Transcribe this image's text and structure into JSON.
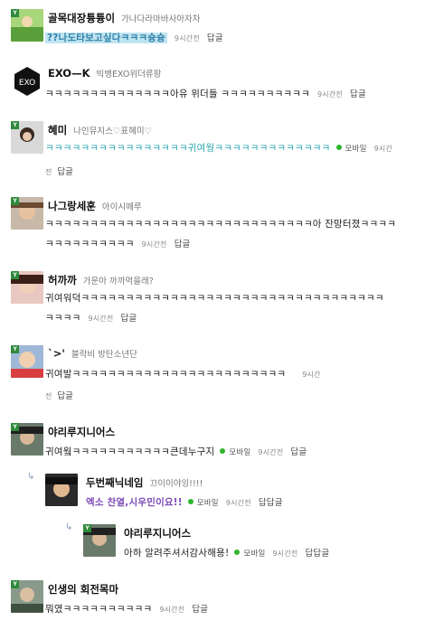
{
  "comments": [
    {
      "nick": "골목대장튱튱이",
      "sub": "가나다라마바사아자차",
      "text": "??나도타보고싶다ㅋㅋㅋ슝슝",
      "time": "9시간전",
      "reply": "답글"
    },
    {
      "nick": "EXO—K",
      "sub": "빅뱅EXO위더류팡",
      "text": "ㅋㅋㅋㅋㅋㅋㅋㅋㅋㅋㅋㅋㅋㅋ아유 위더들 ㅋㅋㅋㅋㅋㅋㅋㅋㅋㅋ",
      "time": "9시간전",
      "reply": "답글"
    },
    {
      "nick": "혜미",
      "sub": "나인뮤지스♡표혜미♡",
      "text": "ㅋㅋㅋㅋㅋㅋㅋㅋㅋㅋㅋㅋㅋㅋㅋㅋ귀여웡ㅋㅋㅋㅋㅋㅋㅋㅋㅋㅋㅋㅋㅋ",
      "mobile": "모바일",
      "time1": "9시간",
      "time2": "전",
      "reply": "답글"
    },
    {
      "nick": "나그랑세훈",
      "sub": "아이시떼루",
      "text1": "ㅋㅋㅋㅋㅋㅋㅋㅋㅋㅋㅋㅋㅋㅋㅋㅋㅋㅋㅋㅋㅋㅋㅋㅋㅋㅋㅋㅋㅋㅋ아 잔망터졌ㅋㅋㅋㅋ",
      "text2": "ㅋㅋㅋㅋㅋㅋㅋㅋㅋㅋ",
      "time": "9시간전",
      "reply": "답글"
    },
    {
      "nick": "허까까",
      "sub": "가운아 까까먹을래?",
      "text1": "귀여워덕ㅋㅋㅋㅋㅋㅋㅋㅋㅋㅋㅋㅋㅋㅋㅋㅋㅋㅋㅋㅋㅋㅋㅋㅋㅋㅋㅋㅋㅋㅋㅋㅋㅋㅋ",
      "text2": "ㅋㅋㅋㅋ",
      "time": "9시간전",
      "reply": "답글"
    },
    {
      "nick": "`>'",
      "sub": "블락비 방탄소년단",
      "text": "귀여발ㅋㅋㅋㅋㅋㅋㅋㅋㅋㅋㅋㅋㅋㅋㅋㅋㅋㅋㅋㅋㅋㅋㅋㅋ",
      "time1": "9시간",
      "time2": "전",
      "reply": "답글"
    },
    {
      "nick": "야리루지니어스",
      "sub": "",
      "text": "귀여웤ㅋㅋㅋㅋㅋㅋㅋㅋㅋㅋㅋ큰데누구지",
      "mobile": "모바일",
      "time": "9시간전",
      "reply": "답글"
    },
    {
      "nick": "두번째닉네임",
      "sub": "끄이이야잉!!!!",
      "text": "엑소 찬열,시우민이요!!",
      "mobile": "모바일",
      "time": "9시간전",
      "reply": "답답글"
    },
    {
      "nick": "야리루지니어스",
      "sub": "",
      "text": "아하 알려주셔서감사해용!",
      "mobile": "모바일",
      "time": "9시간전",
      "reply": "답답글"
    },
    {
      "nick": "인생의 회전목마",
      "sub": "",
      "text": "뭐였ㅋㅋㅋㅋㅋㅋㅋㅋㅋㅋ",
      "time": "9시간전",
      "reply": "답글"
    }
  ],
  "colors": {
    "level_badge": "#2f8a3c",
    "highlight_bg": "#bfe5f2",
    "teal_text": "#2aa4b0",
    "purple_text": "#7a4ab5",
    "mobile_dot": "#2fb52f"
  },
  "icons": {
    "reply_arrow": "reply-arrow-icon",
    "mobile_dot": "mobile-dot-icon",
    "level_badge": "level-badge-icon"
  }
}
